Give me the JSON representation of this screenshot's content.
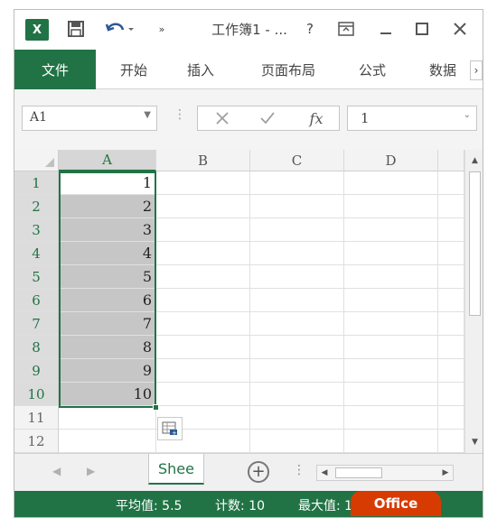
{
  "titlebar": {
    "app_logo": "X",
    "title": "工作簿1 - ...",
    "help": "?",
    "icons": [
      "excel-logo",
      "save-icon",
      "undo-icon",
      "customize-qat-icon",
      "help-icon",
      "ribbon-display-icon",
      "minimize-icon",
      "restore-icon",
      "close-icon"
    ]
  },
  "ribbon": {
    "tabs": [
      {
        "label": "文件",
        "active": true
      },
      {
        "label": "开始"
      },
      {
        "label": "插入"
      },
      {
        "label": "页面布局"
      },
      {
        "label": "公式"
      },
      {
        "label": "数据"
      }
    ],
    "more_arrow": "›"
  },
  "formula_bar": {
    "name_box": "A1",
    "fx": "fx",
    "value": "1"
  },
  "grid": {
    "columns": [
      "A",
      "B",
      "C",
      "D"
    ],
    "rows": [
      "1",
      "2",
      "3",
      "4",
      "5",
      "6",
      "7",
      "8",
      "9",
      "10",
      "11",
      "12"
    ],
    "column_a_values": [
      "1",
      "2",
      "3",
      "4",
      "5",
      "6",
      "7",
      "8",
      "9",
      "10"
    ],
    "selected_range": "A1:A10",
    "accent": "#217346"
  },
  "sheets": {
    "active_tab": "Shee"
  },
  "status_bar": {
    "average": "平均值: 5.5",
    "count": "计数: 10",
    "max": "最大值: 10",
    "watermark": "Office",
    "color": "#217346"
  }
}
